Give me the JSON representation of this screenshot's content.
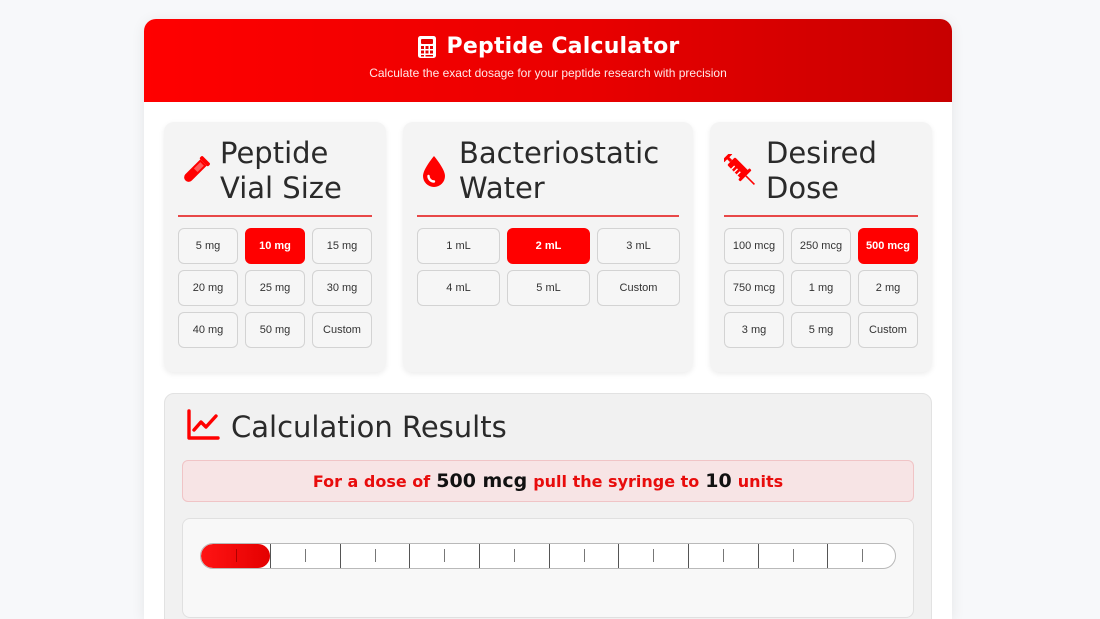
{
  "header": {
    "title": "Peptide Calculator",
    "subtitle": "Calculate the exact dosage for your peptide research with precision",
    "icon": "calculator-icon"
  },
  "vial": {
    "title_line1": "Peptide",
    "title_line2": "Vial Size",
    "icon": "test-tube-icon",
    "options": [
      "5 mg",
      "10 mg",
      "15 mg",
      "20 mg",
      "25 mg",
      "30 mg",
      "40 mg",
      "50 mg",
      "Custom"
    ],
    "selected": "10 mg"
  },
  "water": {
    "title_line1": "Bacteriostatic",
    "title_line2": "Water",
    "icon": "water-drop-icon",
    "options": [
      "1 mL",
      "2 mL",
      "3 mL",
      "4 mL",
      "5 mL",
      "Custom"
    ],
    "selected": "2 mL"
  },
  "dose": {
    "title_line1": "Desired",
    "title_line2": "Dose",
    "icon": "syringe-icon",
    "options": [
      "100 mcg",
      "250 mcg",
      "500 mcg",
      "750 mcg",
      "1 mg",
      "2 mg",
      "3 mg",
      "5 mg",
      "Custom"
    ],
    "selected": "500 mcg"
  },
  "results": {
    "title": "Calculation Results",
    "icon": "chart-line-icon",
    "banner_prefix": "For a dose of",
    "dose_value": "500 mcg",
    "banner_mid": "pull the syringe to",
    "units_value": "10",
    "banner_suffix": "units"
  },
  "syringe": {
    "fill_units": 10,
    "max_units": 100
  },
  "colors": {
    "accent": "#ff0000",
    "accent_dark": "#c70000",
    "rule": "#e84848",
    "banner_bg": "#f7e4e5"
  }
}
